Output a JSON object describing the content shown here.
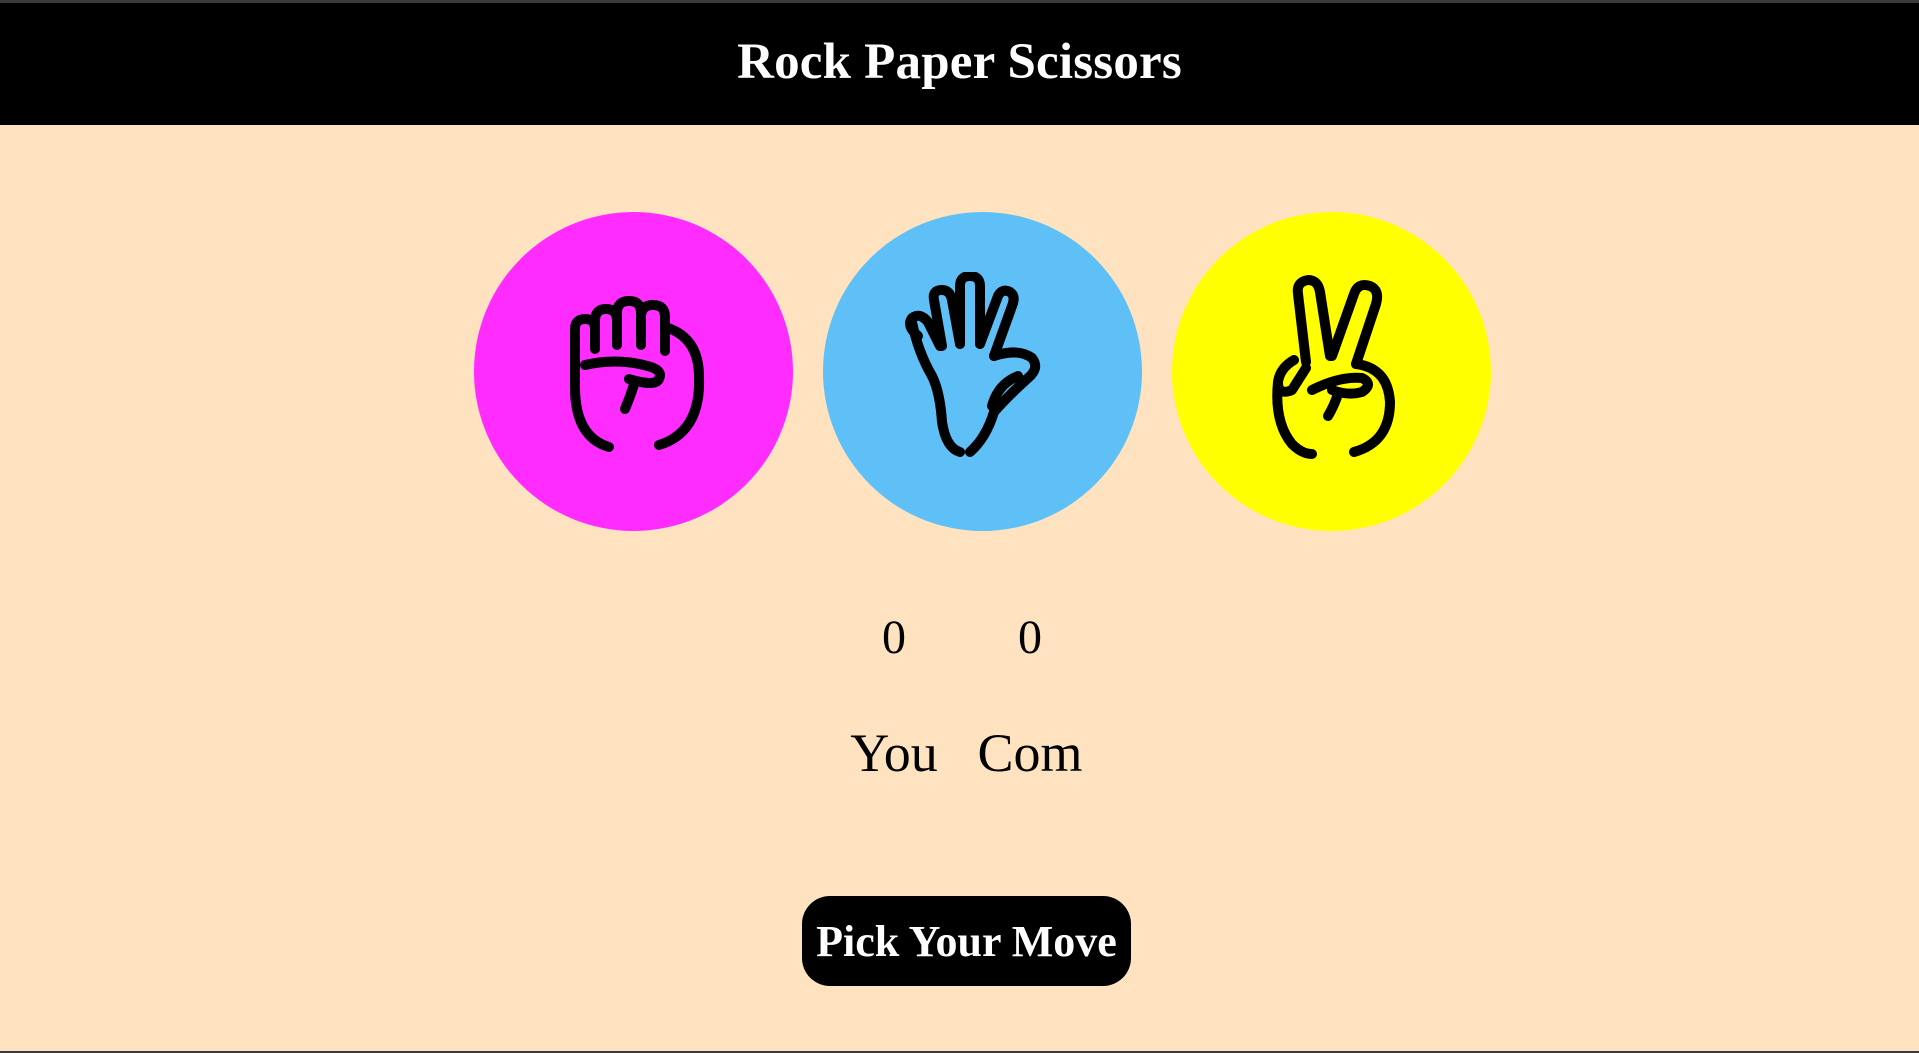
{
  "header": {
    "title": "Rock Paper Scissors"
  },
  "choices": [
    {
      "name": "rock",
      "icon": "raised-fist-icon",
      "color": "#ff2cff"
    },
    {
      "name": "paper",
      "icon": "raised-hand-icon",
      "color": "#5fc0f8"
    },
    {
      "name": "scissors",
      "icon": "victory-hand-icon",
      "color": "#ffff00"
    }
  ],
  "score": {
    "user": {
      "value": "0",
      "label": "You"
    },
    "computer": {
      "value": "0",
      "label": "Com"
    }
  },
  "message": {
    "text": "Pick Your Move"
  },
  "colors": {
    "background": "#ffe3c1",
    "header": "#000000",
    "message_bg": "#000000"
  }
}
